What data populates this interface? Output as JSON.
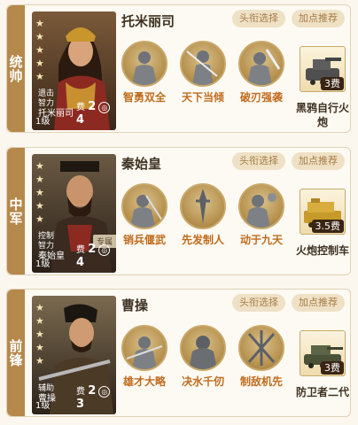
{
  "cards": [
    {
      "position": "统帅",
      "hero_name": "托米丽司",
      "tags": [
        "遗击",
        "智力"
      ],
      "tag_name": "托米丽司",
      "level": "1级",
      "cost_label": "费",
      "cost_value": "2",
      "coin_value": "4",
      "specialty": "",
      "title_button": "头衔选择",
      "points_button": "加点推荐",
      "skills": [
        "智勇双全",
        "天下当倾",
        "破刃强袭"
      ],
      "weapon_name": "黑鸦自行火炮",
      "weapon_cost": "3费"
    },
    {
      "position": "中军",
      "hero_name": "秦始皇",
      "tags": [
        "控制",
        "智力"
      ],
      "tag_name": "秦始皇",
      "level": "1级",
      "cost_label": "费",
      "cost_value": "2",
      "coin_value": "4",
      "specialty": "专属",
      "title_button": "头衔选择",
      "points_button": "加点推荐",
      "skills": [
        "销兵偃武",
        "先发制人",
        "动于九天"
      ],
      "weapon_name": "火炮控制车",
      "weapon_cost": "3.5费"
    },
    {
      "position": "前锋",
      "hero_name": "曹操",
      "tags": [
        "辅助"
      ],
      "tag_name": "曹操",
      "level": "1级",
      "cost_label": "费",
      "cost_value": "2",
      "coin_value": "3",
      "specialty": "",
      "title_button": "头衔选择",
      "points_button": "加点推荐",
      "skills": [
        "雄才大略",
        "决水千仞",
        "制敌机先"
      ],
      "weapon_name": "防卫者二代",
      "weapon_cost": "3费"
    }
  ],
  "colors": {
    "accent": "#b5884b",
    "skill_text": "#c06b1d",
    "button_bg": "#efe1c6",
    "button_text": "#a57c45"
  },
  "icons": [
    "star-icon",
    "coin-icon",
    "skill-icon",
    "tank-icon"
  ]
}
